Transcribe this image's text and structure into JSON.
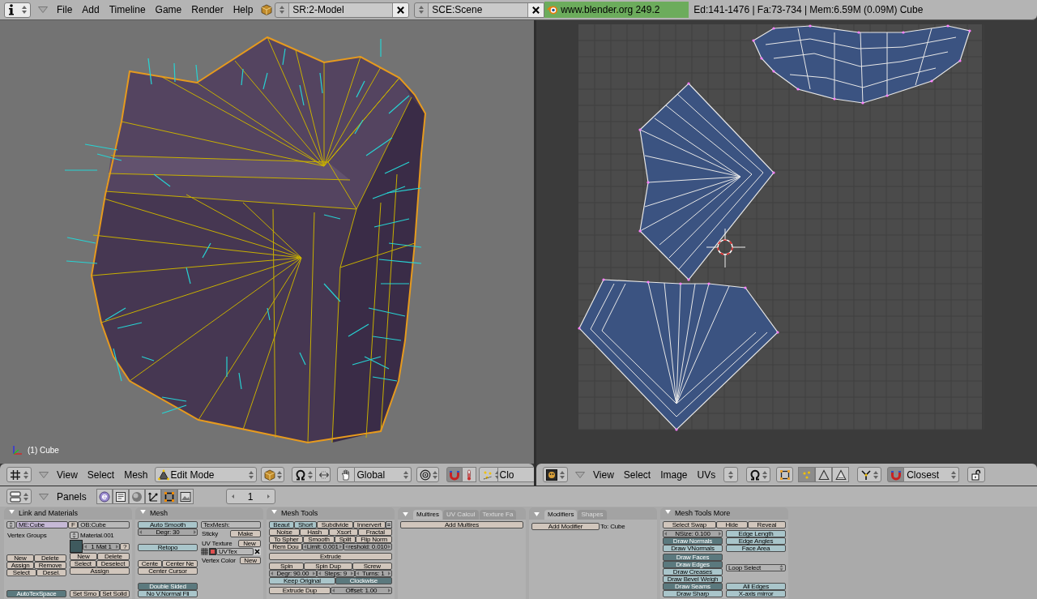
{
  "top_bar": {
    "menus": [
      "File",
      "Add",
      "Timeline",
      "Game",
      "Render",
      "Help"
    ],
    "screen": "SR:2-Model",
    "scene": "SCE:Scene",
    "version": "www.blender.org 249.2",
    "stats": "Ed:141-1476 | Fa:73-734 | Mem:6.59M (0.09M) Cube"
  },
  "view3d": {
    "object_label": "(1) Cube",
    "header": {
      "menus": [
        "View",
        "Select",
        "Mesh"
      ],
      "mode": "Edit Mode",
      "orientation": "Global",
      "snap_on": true,
      "snap_target": "Clo"
    }
  },
  "uv_editor": {
    "header": {
      "menus": [
        "View",
        "Select",
        "Image",
        "UVs"
      ],
      "select_modes": [
        {
          "selected": true
        },
        {
          "selected": false
        },
        {
          "selected": false
        }
      ],
      "snap_on": true,
      "snap_target": "Closest"
    }
  },
  "buttons_window": {
    "header": {
      "label": "Panels",
      "context_tabs": [
        {
          "selected": false
        },
        {
          "selected": false
        },
        {
          "selected": false
        },
        {
          "selected": false
        },
        {
          "selected": true
        },
        {
          "selected": false
        }
      ],
      "page": "1"
    },
    "panels": [
      {
        "title": "Link and Materials",
        "blocks": [
          {
            "kind": "rows",
            "groups": [
              [
                [
                  {
                    "kind": "browse"
                  },
                  {
                    "kind": "idfield",
                    "value": "ME:Cube"
                  },
                  {
                    "kind": "mini",
                    "label": "F"
                  },
                  {
                    "kind": "field",
                    "value": "OB:Cube"
                  }
                ]
              ]
            ]
          },
          {
            "kind": "columns",
            "columns": [
              [
                [
                  [
                    {
                      "kind": "text",
                      "label": "Vertex Groups"
                    }
                  ]
                ],
                [
                  [
                    {
                      "kind": "button",
                      "label": "New"
                    },
                    {
                      "kind": "button",
                      "label": "Delete"
                    }
                  ],
                  [
                    {
                      "kind": "button",
                      "label": "Assign"
                    },
                    {
                      "kind": "button",
                      "label": "Remove"
                    }
                  ],
                  [
                    {
                      "kind": "button",
                      "label": "Select"
                    },
                    {
                      "kind": "button",
                      "label": "Desel."
                    }
                  ]
                ],
                [
                  [
                    {
                      "kind": "toggle",
                      "label": "AutoTexSpace",
                      "on": true
                    }
                  ]
                ]
              ],
              [
                [
                  [
                    {
                      "kind": "browse"
                    },
                    {
                      "kind": "text",
                      "label": "Material.001"
                    }
                  ],
                  [
                    {
                      "kind": "swatch"
                    },
                    {
                      "kind": "number",
                      "label": "1 Mat 1"
                    },
                    {
                      "kind": "mini",
                      "label": "?"
                    }
                  ],
                  [
                    {
                      "kind": "button",
                      "label": "New"
                    },
                    {
                      "kind": "button",
                      "label": "Delete"
                    }
                  ],
                  [
                    {
                      "kind": "button",
                      "label": "Select"
                    },
                    {
                      "kind": "button",
                      "label": "Deselect"
                    }
                  ],
                  [
                    {
                      "kind": "button",
                      "label": "Assign"
                    }
                  ]
                ],
                [
                  [
                    {
                      "kind": "button",
                      "label": "Set Smo"
                    },
                    {
                      "kind": "button",
                      "label": "Set Solid"
                    }
                  ]
                ]
              ]
            ]
          }
        ]
      },
      {
        "title": "Mesh",
        "blocks": [
          {
            "kind": "columns",
            "columns": [
              [
                [
                  [
                    {
                      "kind": "toggle",
                      "label": "Auto Smooth",
                      "on": false
                    }
                  ],
                  [
                    {
                      "kind": "number",
                      "label": "Degr: 30"
                    }
                  ]
                ],
                [
                  [
                    {
                      "kind": "toggle",
                      "label": "Retopo",
                      "on": false
                    }
                  ]
                ],
                [
                  [
                    {
                      "kind": "button",
                      "label": "Cente"
                    },
                    {
                      "kind": "button",
                      "label": "Center Ne"
                    }
                  ],
                  [
                    {
                      "kind": "button",
                      "label": "Center Cursor"
                    }
                  ]
                ],
                [
                  [
                    {
                      "kind": "toggle",
                      "label": "Double Sided",
                      "on": true
                    }
                  ],
                  [
                    {
                      "kind": "toggle",
                      "label": "No V.Normal Fli",
                      "on": false
                    }
                  ]
                ]
              ],
              [
                [
                  [
                    {
                      "kind": "field",
                      "value": "TexMesh:"
                    }
                  ],
                  [
                    {
                      "kind": "text",
                      "label": "Sticky"
                    },
                    {
                      "kind": "button",
                      "label": "Make"
                    }
                  ],
                  [
                    {
                      "kind": "text",
                      "label": "UV Texture"
                    },
                    {
                      "kind": "button",
                      "label": "New"
                    }
                  ],
                  [
                    {
                      "kind": "gridicon"
                    },
                    {
                      "kind": "imageicon"
                    },
                    {
                      "kind": "field",
                      "value": "UVTex"
                    },
                    {
                      "kind": "xbutton"
                    }
                  ],
                  [
                    {
                      "kind": "text",
                      "label": "Vertex Color"
                    },
                    {
                      "kind": "button",
                      "label": "New"
                    }
                  ]
                ]
              ]
            ]
          }
        ]
      },
      {
        "title": "Mesh Tools",
        "blocks": [
          {
            "kind": "rows",
            "groups": [
              [
                [
                  {
                    "kind": "toggle",
                    "label": "Beaut",
                    "on": false
                  },
                  {
                    "kind": "toggle",
                    "label": "Short",
                    "on": false
                  },
                  {
                    "kind": "button",
                    "label": "Subdivide"
                  },
                  {
                    "kind": "button",
                    "label": "Innervert"
                  },
                  {
                    "kind": "menuicon"
                  }
                ],
                [
                  {
                    "kind": "button",
                    "label": "Noise"
                  },
                  {
                    "kind": "button",
                    "label": "Hash"
                  },
                  {
                    "kind": "button",
                    "label": "Xsort"
                  },
                  {
                    "kind": "button",
                    "label": "Fractal"
                  }
                ],
                [
                  {
                    "kind": "button",
                    "label": "To Spher"
                  },
                  {
                    "kind": "button",
                    "label": "Smooth"
                  },
                  {
                    "kind": "button",
                    "label": "Split"
                  },
                  {
                    "kind": "button",
                    "label": "Flip Norm"
                  }
                ],
                [
                  {
                    "kind": "button",
                    "label": "Rem Dou"
                  },
                  {
                    "kind": "number",
                    "label": "Limit: 0.001"
                  },
                  {
                    "kind": "number",
                    "label": "reshold: 0.010"
                  }
                ]
              ],
              [
                [
                  {
                    "kind": "button",
                    "label": "Extrude"
                  }
                ]
              ],
              [
                [
                  {
                    "kind": "button",
                    "label": "Spin"
                  },
                  {
                    "kind": "button",
                    "label": "Spin Dup"
                  },
                  {
                    "kind": "button",
                    "label": "Screw"
                  }
                ],
                [
                  {
                    "kind": "number",
                    "label": "Degr: 90.00"
                  },
                  {
                    "kind": "number",
                    "label": "Steps: 9"
                  },
                  {
                    "kind": "number",
                    "label": "Turns: 1"
                  }
                ],
                [
                  {
                    "kind": "toggle",
                    "label": "Keep Original",
                    "on": false
                  },
                  {
                    "kind": "toggle",
                    "label": "Clockwise",
                    "on": true
                  }
                ]
              ],
              [
                [
                  {
                    "kind": "button",
                    "label": "Extrude Dup"
                  },
                  {
                    "kind": "number",
                    "label": "Offset: 1.00"
                  }
                ]
              ]
            ]
          }
        ]
      },
      {
        "tabs": [
          {
            "label": "Multires",
            "selected": true
          },
          {
            "label": "UV Calcul",
            "selected": false
          },
          {
            "label": "Texture Fa",
            "selected": false
          }
        ],
        "blocks": [
          {
            "kind": "rows",
            "groups": [
              [
                [
                  {
                    "kind": "button",
                    "label": "Add Multires"
                  }
                ]
              ]
            ]
          }
        ]
      },
      {
        "tabs": [
          {
            "label": "Modifiers",
            "selected": true
          },
          {
            "label": "Shapes",
            "selected": false
          }
        ],
        "blocks": [
          {
            "kind": "rows",
            "groups": [
              [
                [
                  {
                    "kind": "button",
                    "label": "Add Modifier"
                  },
                  {
                    "kind": "text",
                    "label": "To: Cube"
                  }
                ]
              ]
            ]
          }
        ]
      },
      {
        "title": "Mesh Tools More",
        "blocks": [
          {
            "kind": "rows",
            "groups": [
              [
                [
                  {
                    "kind": "button",
                    "label": "Select Swap"
                  },
                  {
                    "kind": "button",
                    "label": "Hide"
                  },
                  {
                    "kind": "button",
                    "label": "Reveal"
                  }
                ]
              ]
            ]
          },
          {
            "kind": "columns",
            "columns": [
              [
                [
                  [
                    {
                      "kind": "number",
                      "label": "NSize: 0.100"
                    }
                  ],
                  [
                    {
                      "kind": "toggle",
                      "label": "Draw Normals",
                      "on": true
                    }
                  ],
                  [
                    {
                      "kind": "toggle",
                      "label": "Draw VNormals",
                      "on": false
                    }
                  ]
                ],
                [
                  [
                    {
                      "kind": "toggle",
                      "label": "Draw Faces",
                      "on": true
                    }
                  ],
                  [
                    {
                      "kind": "toggle",
                      "label": "Draw Edges",
                      "on": true
                    }
                  ],
                  [
                    {
                      "kind": "toggle",
                      "label": "Draw Creases",
                      "on": false
                    }
                  ],
                  [
                    {
                      "kind": "toggle",
                      "label": "Draw Bevel Weigh",
                      "on": false
                    }
                  ],
                  [
                    {
                      "kind": "toggle",
                      "label": "Draw Seams",
                      "on": true
                    }
                  ],
                  [
                    {
                      "kind": "toggle",
                      "label": "Draw Sharp",
                      "on": false
                    }
                  ]
                ]
              ],
              [
                [
                  [
                    {
                      "kind": "toggle",
                      "label": "Edge Length",
                      "on": false
                    }
                  ],
                  [
                    {
                      "kind": "toggle",
                      "label": "Edge Angles",
                      "on": false
                    }
                  ],
                  [
                    {
                      "kind": "toggle",
                      "label": "Face Area",
                      "on": false
                    }
                  ]
                ],
                [
                  [
                    {
                      "kind": "menu",
                      "label": "Loop Select"
                    }
                  ]
                ],
                [
                  [
                    {
                      "kind": "toggle",
                      "label": "All Edges",
                      "on": false
                    }
                  ],
                  [
                    {
                      "kind": "toggle",
                      "label": "X-axis mirror",
                      "on": false
                    }
                  ]
                ]
              ]
            ]
          }
        ]
      }
    ]
  }
}
